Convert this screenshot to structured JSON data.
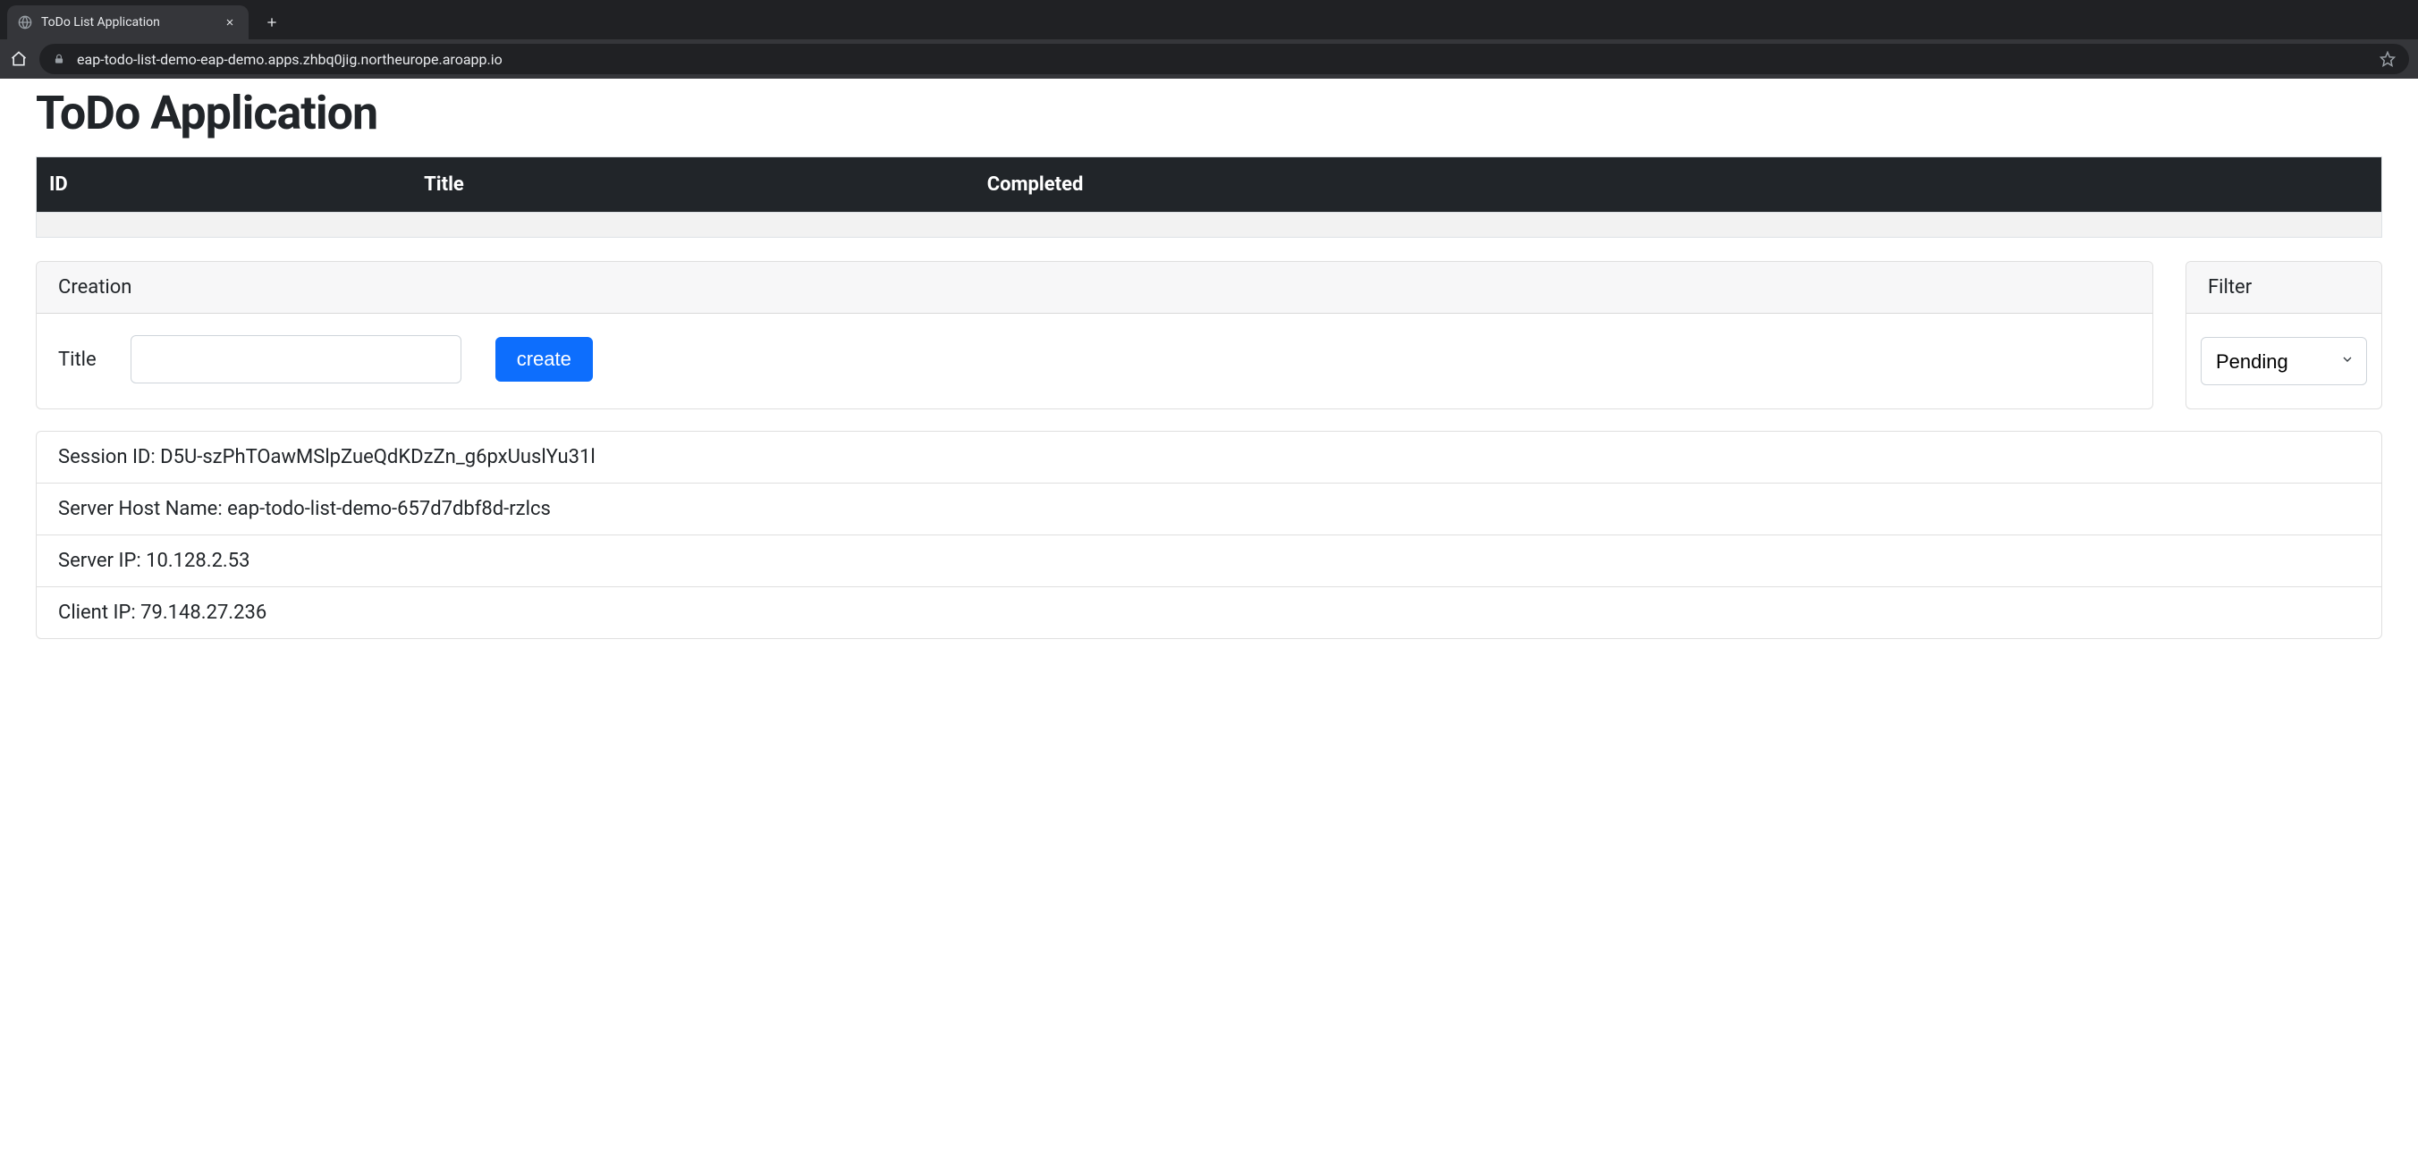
{
  "browser": {
    "tab_title": "ToDo List Application",
    "url": "eap-todo-list-demo-eap-demo.apps.zhbq0jig.northeurope.aroapp.io"
  },
  "page": {
    "title": "ToDo Application"
  },
  "table": {
    "headers": {
      "id": "ID",
      "title": "Title",
      "completed": "Completed"
    },
    "rows": []
  },
  "creation": {
    "header": "Creation",
    "title_label": "Title",
    "title_value": "",
    "button_label": "create"
  },
  "filter": {
    "header": "Filter",
    "selected": "Pending",
    "options": [
      "Pending"
    ]
  },
  "info": {
    "session_label": "Session ID:",
    "session_value": "D5U-szPhTOawMSlpZueQdKDzZn_g6pxUuslYu31l",
    "server_host_label": "Server Host Name:",
    "server_host_value": "eap-todo-list-demo-657d7dbf8d-rzlcs",
    "server_ip_label": "Server IP:",
    "server_ip_value": "10.128.2.53",
    "client_ip_label": "Client IP:",
    "client_ip_value": "79.148.27.236"
  }
}
